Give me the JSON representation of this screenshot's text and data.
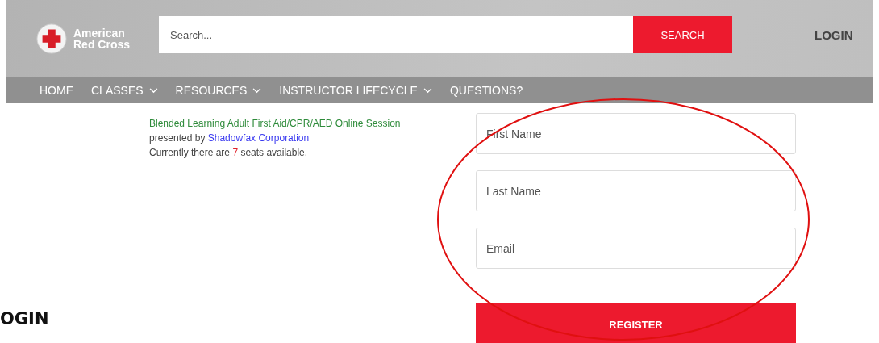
{
  "header": {
    "logo_text": [
      "American",
      "Red Cross"
    ],
    "search": {
      "placeholder": "Search..."
    },
    "search_button": "SEARCH",
    "login": "LOGIN"
  },
  "nav": [
    {
      "label": "HOME",
      "dropdown": false
    },
    {
      "label": "CLASSES",
      "dropdown": true
    },
    {
      "label": "RESOURCES",
      "dropdown": true
    },
    {
      "label": "INSTRUCTOR LIFECYCLE",
      "dropdown": true
    },
    {
      "label": "QUESTIONS?",
      "dropdown": false
    }
  ],
  "session": {
    "title": "Blended Learning Adult First Aid/CPR/AED Online Session",
    "presented_by": "presented by",
    "provider": "Shadowfax Corporation",
    "seats_before": "Currently there are",
    "seats_count": "7",
    "seats_after": "seats available."
  },
  "form": {
    "fields": [
      {
        "placeholder": "First Name"
      },
      {
        "placeholder": "Last Name"
      },
      {
        "placeholder": "Email"
      }
    ],
    "register": "REGISTER"
  },
  "caption": "OGIN"
}
